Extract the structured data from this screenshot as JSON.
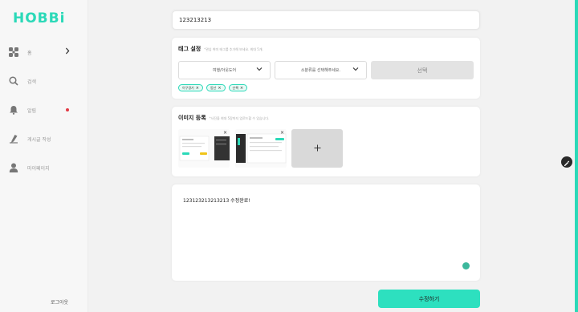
{
  "brand": {
    "logo": "HOBBi",
    "accent": "#2bd9b8"
  },
  "sidebar": {
    "items": [
      {
        "label": "홈",
        "icon": "puzzle-icon"
      },
      {
        "label": "검색",
        "icon": "search-icon"
      },
      {
        "label": "알림",
        "icon": "bell-icon"
      },
      {
        "label": "게시글 작성",
        "icon": "pen-icon"
      },
      {
        "label": "마이페이지",
        "icon": "user-icon"
      }
    ],
    "logout_label": "로그아웃"
  },
  "post": {
    "title_value": "123213213",
    "tags": {
      "title": "태그 설정",
      "hint": "*관심 취미 태그를 추가해 보세요. 최대 5개.",
      "category_select": "여행/아웃도어",
      "sub_select": "소분류를 선택해주세요.",
      "select_button": "선택",
      "chips": [
        {
          "label": "이구경기"
        },
        {
          "label": "동산"
        },
        {
          "label": "산책"
        }
      ]
    },
    "images": {
      "title": "이미지 등록",
      "hint": "*사진을 최대 5장까지 업로드할 수 있습니다."
    },
    "content_value": "123123213213213 수정완료!",
    "submit_label": "수정하기"
  }
}
